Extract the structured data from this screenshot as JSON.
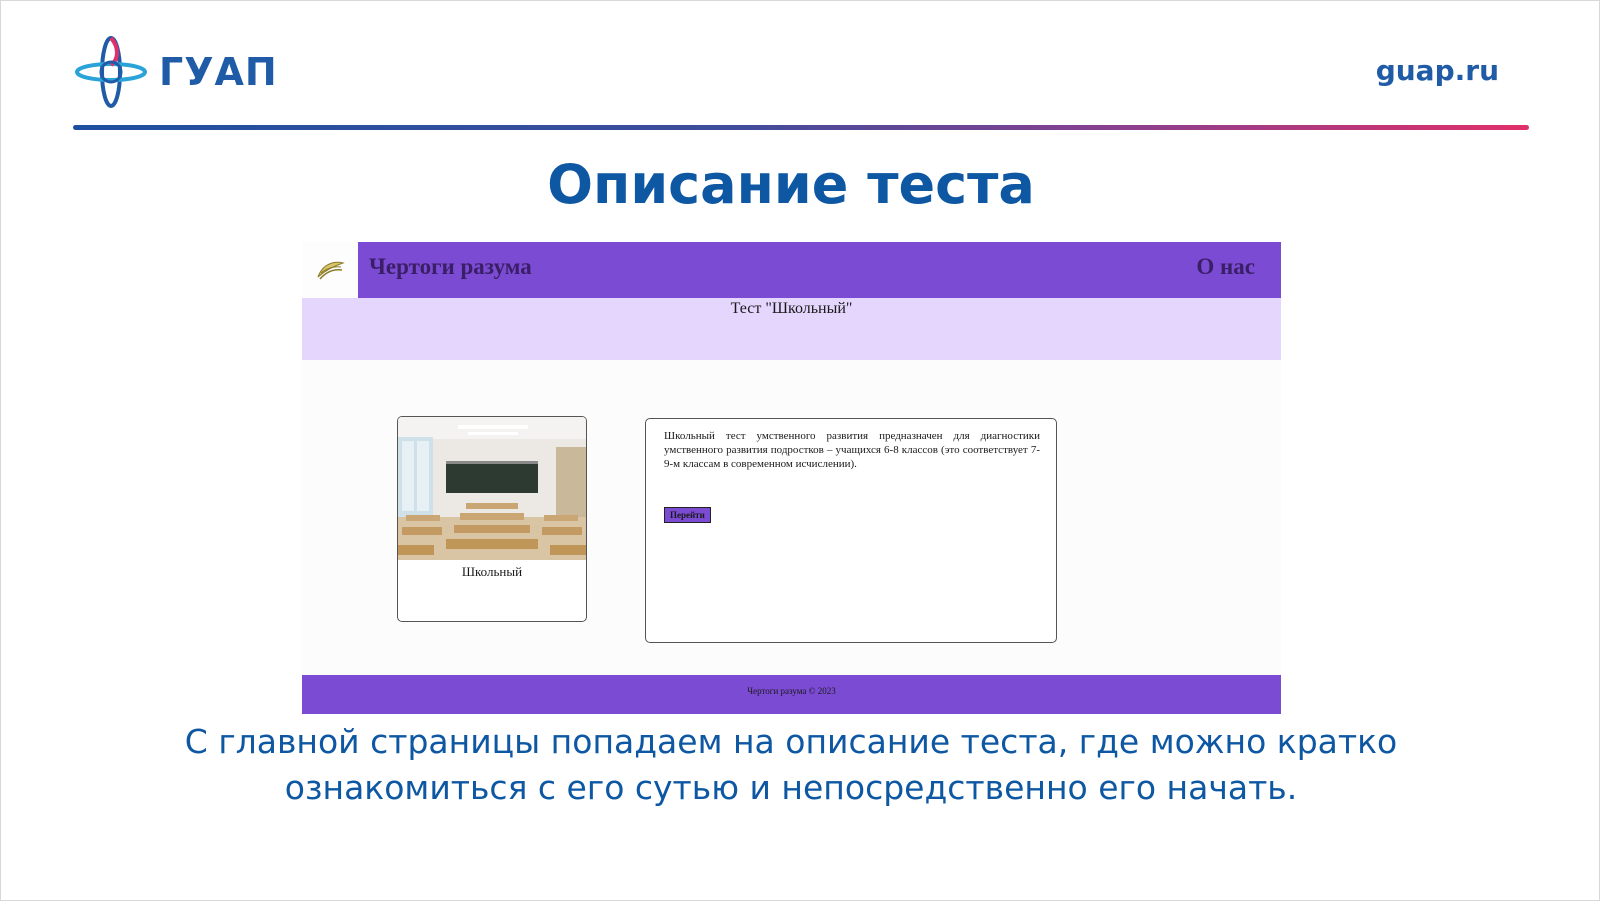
{
  "header": {
    "logo_text": "ГУАП",
    "site": "guap.ru"
  },
  "slide": {
    "title": "Описание теста",
    "caption_line1": "С главной страницы попадаем на описание теста, где можно кратко",
    "caption_line2": "ознакомиться с его сутью и непосредственно его начать."
  },
  "screenshot": {
    "brand": "Чертоги разума",
    "nav_about": "О нас",
    "band_title": "Тест \"Школьный\"",
    "card_label": "Школьный",
    "description": "Школьный тест умственного развития предназначен для диагностики умственного развития подростков – учащихся 6-8 классов (это соответствует 7-9-м классам в современном исчислении).",
    "go_button": "Перейти",
    "footer": "Чертоги разума © 2023"
  },
  "colors": {
    "brand_blue": "#0d57a3",
    "nav_purple": "#7b4bd4",
    "band_lavender": "#e4d6fd",
    "rule_start": "#1d4fa0",
    "rule_end": "#e0306a"
  }
}
